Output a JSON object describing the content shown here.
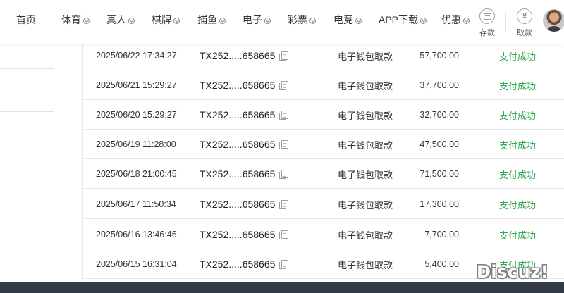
{
  "nav": {
    "items": [
      {
        "label": "首页",
        "dropdown": false
      },
      {
        "label": "体育",
        "dropdown": true
      },
      {
        "label": "真人",
        "dropdown": true
      },
      {
        "label": "棋牌",
        "dropdown": true
      },
      {
        "label": "捕鱼",
        "dropdown": true
      },
      {
        "label": "电子",
        "dropdown": true
      },
      {
        "label": "彩票",
        "dropdown": true
      },
      {
        "label": "电竞",
        "dropdown": true
      },
      {
        "label": "APP下载",
        "dropdown": true
      },
      {
        "label": "优惠",
        "dropdown": true
      }
    ],
    "deposit_label": "存款",
    "withdraw_label": "取款",
    "withdraw_symbol": "¥",
    "icons": [
      "chevron-down-icon",
      "wallet-icon",
      "yen-icon",
      "avatar"
    ]
  },
  "transactions": [
    {
      "time": "2025/06/22 17:34:27",
      "order": "TX252.....658665",
      "type": "电子钱包取款",
      "amount": "57,700.00",
      "status": "支付成功"
    },
    {
      "time": "2025/06/21 15:29:27",
      "order": "TX252.....658665",
      "type": "电子钱包取款",
      "amount": "37,700.00",
      "status": "支付成功"
    },
    {
      "time": "2025/06/20 15:29:27",
      "order": "TX252.....658665",
      "type": "电子钱包取款",
      "amount": "32,700.00",
      "status": "支付成功"
    },
    {
      "time": "2025/06/19 11:28:00",
      "order": "TX252.....658665",
      "type": "电子钱包取款",
      "amount": "47,500.00",
      "status": "支付成功"
    },
    {
      "time": "2025/06/18 21:00:45",
      "order": "TX252.....658665",
      "type": "电子钱包取款",
      "amount": "71,500.00",
      "status": "支付成功"
    },
    {
      "time": "2025/06/17 11:50:34",
      "order": "TX252.....658665",
      "type": "电子钱包取款",
      "amount": "17,300.00",
      "status": "支付成功"
    },
    {
      "time": "2025/06/16 13:46:46",
      "order": "TX252.....658665",
      "type": "电子钱包取款",
      "amount": "7,700.00",
      "status": "支付成功"
    },
    {
      "time": "2025/06/15 16:31:04",
      "order": "TX252.....658665",
      "type": "电子钱包取款",
      "amount": "5,400.00",
      "status": "支付成功"
    }
  ],
  "colors": {
    "status_success": "#2fa84f",
    "bottom_bar": "#353a47"
  },
  "watermark": "Discuz!"
}
